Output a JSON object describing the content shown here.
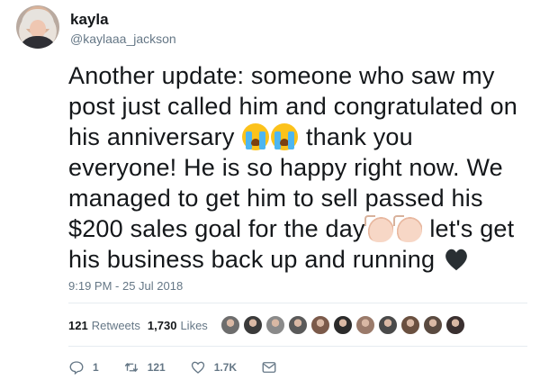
{
  "user": {
    "name": "kayla",
    "handle": "@kaylaaa_jackson"
  },
  "tweet": {
    "text_part1": "Another update: someone who saw my post just called him and congratulated on his anniversary ",
    "text_part2": " thank you everyone! He is so happy right now. We managed to get him to sell passed his $200 sales goal for the day",
    "text_part3": " let's get his business back up and running ",
    "emojis": [
      "loudly-crying-face",
      "loudly-crying-face",
      "clapping-hands",
      "clapping-hands",
      "black-heart"
    ],
    "timestamp": "9:19 PM - 25 Jul 2018"
  },
  "stats": {
    "retweets_count": "121",
    "retweets_label": "Retweets",
    "likes_count": "1,730",
    "likes_label": "Likes",
    "liker_avatars": [
      "#6d6d6d",
      "#3a3a3a",
      "#8a8a8a",
      "#5a5a5a",
      "#7b5a4a",
      "#2b2b2b",
      "#9a7a6a",
      "#4a4a4a",
      "#6a5040",
      "#5a4a40",
      "#3a3030"
    ]
  },
  "actions": {
    "reply_count": "1",
    "retweet_count": "121",
    "like_count": "1.7K",
    "dm": ""
  },
  "colors": {
    "text": "#14171a",
    "secondary": "#657786",
    "divider": "#e6ecf0"
  }
}
